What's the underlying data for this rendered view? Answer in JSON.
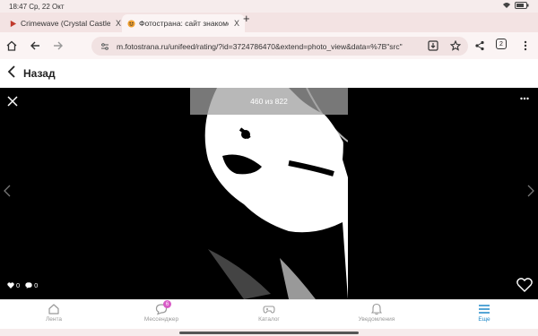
{
  "status": {
    "time": "18:47 Ср, 22 Окт"
  },
  "tabs": [
    {
      "title": "Crimewave (Crystal Castles",
      "close": "X"
    },
    {
      "title": "Фотострана: сайт знакомст",
      "close": "X"
    }
  ],
  "tab_plus": "+",
  "toolbar": {
    "url": "m.fotostrana.ru/unifeed/rating/?id=3724786470&extend=photo_view&data=%7B\"src\"",
    "tab_count": "2"
  },
  "page": {
    "back_label": "Назад"
  },
  "viewer": {
    "counter": "460 из 822",
    "likes": "0",
    "comments": "0"
  },
  "nav": [
    {
      "label": "Лента",
      "icon": "home-icon"
    },
    {
      "label": "Мессенджер",
      "icon": "chat-icon",
      "badge": "6"
    },
    {
      "label": "Каталог",
      "icon": "gamepad-icon"
    },
    {
      "label": "Уведомления",
      "icon": "bell-icon"
    },
    {
      "label": "Еще",
      "icon": "menu-icon",
      "active": true
    }
  ],
  "colors": {
    "accent": "#1e88c8",
    "badge": "#d85ac6",
    "tab_fav_youtube": "#c0392b"
  }
}
